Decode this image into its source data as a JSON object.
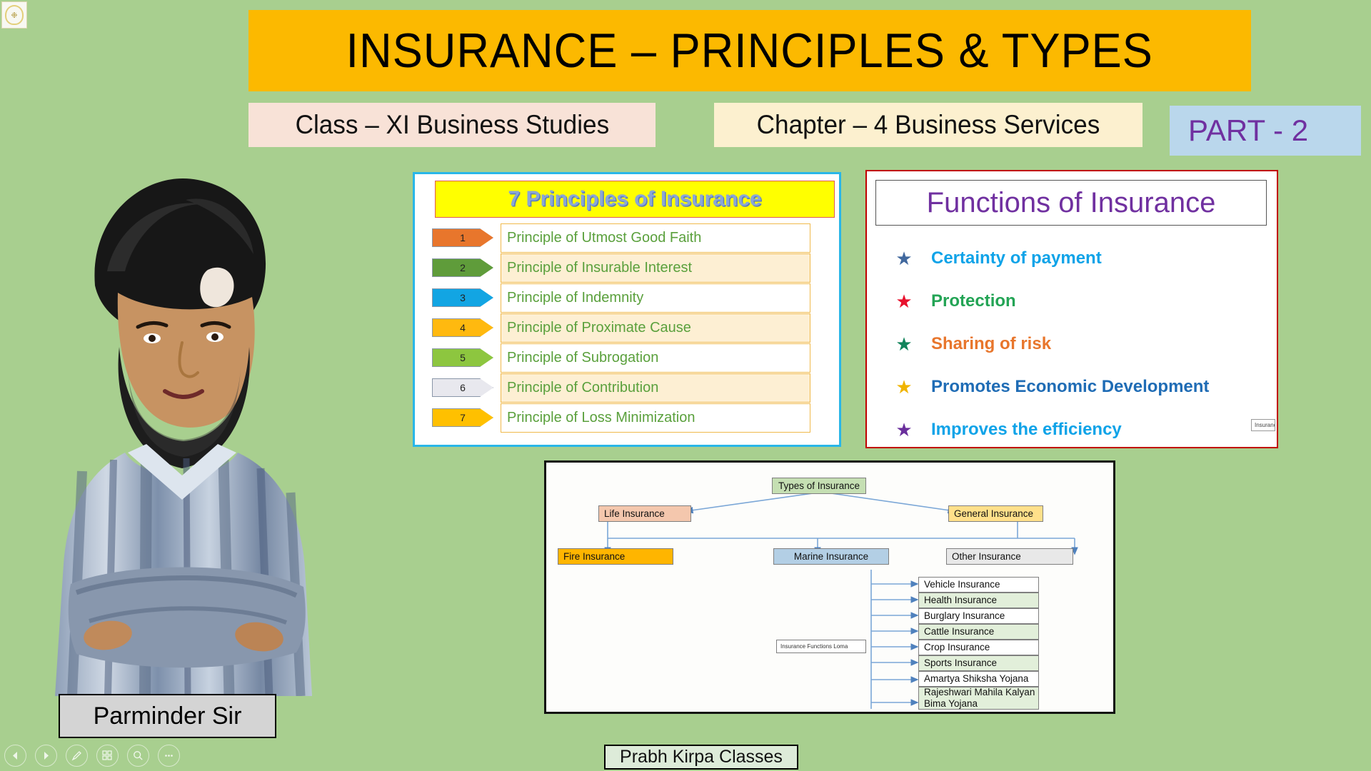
{
  "slide": {
    "background_color": "#a8cf8f",
    "watermark": "slide-watermark"
  },
  "header": {
    "title": "INSURANCE – PRINCIPLES  &  TYPES",
    "title_bg": "#fcb900",
    "class_label": "Class – XI  Business Studies",
    "class_bg": "#f8e2d7",
    "chapter_label": "Chapter – 4  Business Services",
    "chapter_bg": "#fcf0cf",
    "part_label": "PART - 2",
    "part_bg": "#bad7ec",
    "part_color": "#7030a0"
  },
  "presenter": {
    "name": "Parminder Sir"
  },
  "principles_panel": {
    "title": "7 Principles of  Insurance",
    "title_bg": "#ffff00",
    "title_color": "#8aa6d6",
    "border_color": "#29b6e8",
    "items": [
      {
        "number": "1",
        "label": "Principle of Utmost Good Faith",
        "chip_color": "#e8762c"
      },
      {
        "number": "2",
        "label": "Principle of Insurable Interest",
        "chip_color": "#5f9c3a"
      },
      {
        "number": "3",
        "label": "Principle of Indemnity",
        "chip_color": "#12a5e3"
      },
      {
        "number": "4",
        "label": "Principle of Proximate Cause",
        "chip_color": "#ffb90f"
      },
      {
        "number": "5",
        "label": "Principle of Subrogation",
        "chip_color": "#8dc63f"
      },
      {
        "number": "6",
        "label": "Principle of Contribution",
        "chip_color": "#e8e8ee"
      },
      {
        "number": "7",
        "label": "Principle of Loss Minimization",
        "chip_color": "#ffc000"
      }
    ]
  },
  "functions_panel": {
    "title": "Functions of Insurance",
    "title_color": "#7030a0",
    "border_color": "#c00000",
    "badge": "Insurance",
    "items": [
      {
        "label": "Certainty of payment",
        "text_color": "#0fa3e8",
        "star_color": "#41689e"
      },
      {
        "label": "Protection",
        "text_color": "#23a455",
        "star_color": "#e8112d"
      },
      {
        "label": "Sharing of risk",
        "text_color": "#e8762c",
        "star_color": "#11845b"
      },
      {
        "label": "Promotes Economic Development",
        "text_color": "#1f6cb5",
        "star_color": "#f0b400"
      },
      {
        "label": "Improves the efficiency",
        "text_color": "#0fa3e8",
        "star_color": "#6a2f9c"
      }
    ]
  },
  "types_diagram": {
    "root": {
      "label": "Types of Insurance",
      "color": "#c5dfb3"
    },
    "level2": [
      {
        "label": "Life Insurance",
        "color": "#f4c7ad"
      },
      {
        "label": "General Insurance",
        "color": "#ffe08a"
      }
    ],
    "level3": [
      {
        "label": "Fire Insurance",
        "color": "#ffb500"
      },
      {
        "label": "Marine Insurance",
        "color": "#b3cfe5"
      },
      {
        "label": "Other Insurance",
        "color": "#e8e8e8"
      }
    ],
    "tooltip": "Insurance Functions Loma",
    "other_items": [
      {
        "label": "Vehicle Insurance",
        "color": "#ffffff"
      },
      {
        "label": "Health Insurance",
        "color": "#e2efda"
      },
      {
        "label": "Burglary Insurance",
        "color": "#ffffff"
      },
      {
        "label": "Cattle Insurance",
        "color": "#e2efda"
      },
      {
        "label": "Crop Insurance",
        "color": "#ffffff"
      },
      {
        "label": "Sports Insurance",
        "color": "#e2efda"
      },
      {
        "label": "Amartya Shiksha Yojana",
        "color": "#ffffff"
      },
      {
        "label": "Rajeshwari Mahila Kalyan Bima Yojana",
        "color": "#e2efda"
      }
    ]
  },
  "footer": {
    "brand": "Prabh Kirpa Classes"
  },
  "toolbar": {
    "buttons": [
      {
        "name": "previous-slide-button",
        "icon": "triangle-left-icon"
      },
      {
        "name": "next-slide-button",
        "icon": "triangle-right-icon"
      },
      {
        "name": "pen-tool-button",
        "icon": "pen-icon"
      },
      {
        "name": "slide-overview-button",
        "icon": "grid-icon"
      },
      {
        "name": "zoom-button",
        "icon": "magnifier-icon"
      },
      {
        "name": "more-options-button",
        "icon": "ellipsis-icon"
      }
    ]
  }
}
